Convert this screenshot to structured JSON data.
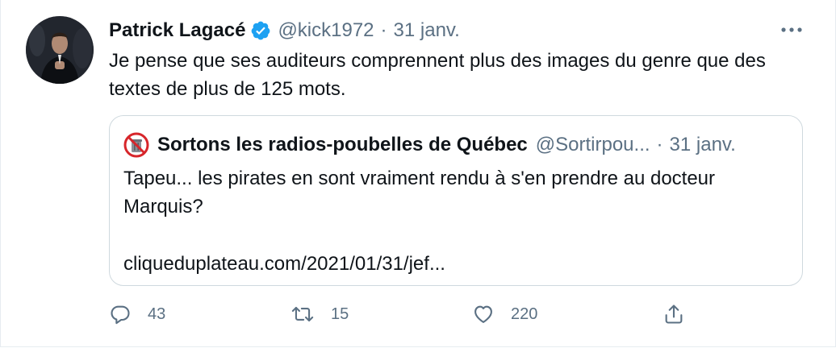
{
  "tweet": {
    "display_name": "Patrick Lagacé",
    "handle": "@kick1972",
    "separator": "·",
    "date": "31 janv.",
    "text": "Je pense que ses auditeurs comprennent plus des images du genre que des textes de plus de 125 mots."
  },
  "quoted": {
    "display_name": "Sortons les radios-poubelles de Québec",
    "handle": "@Sortirpou...",
    "separator": "·",
    "date": "31 janv.",
    "text": "Tapeu... les pirates en sont vraiment rendu à s'en prendre au docteur Marquis?",
    "link": "cliqueduplateau.com/2021/01/31/jef..."
  },
  "actions": {
    "reply_count": "43",
    "retweet_count": "15",
    "like_count": "220"
  },
  "colors": {
    "verified": "#1da1f2",
    "muted": "#5b7083",
    "border": "#cfd9de"
  },
  "icons": [
    "verified-badge-icon",
    "more-icon",
    "reply-icon",
    "retweet-icon",
    "like-icon",
    "share-icon"
  ]
}
